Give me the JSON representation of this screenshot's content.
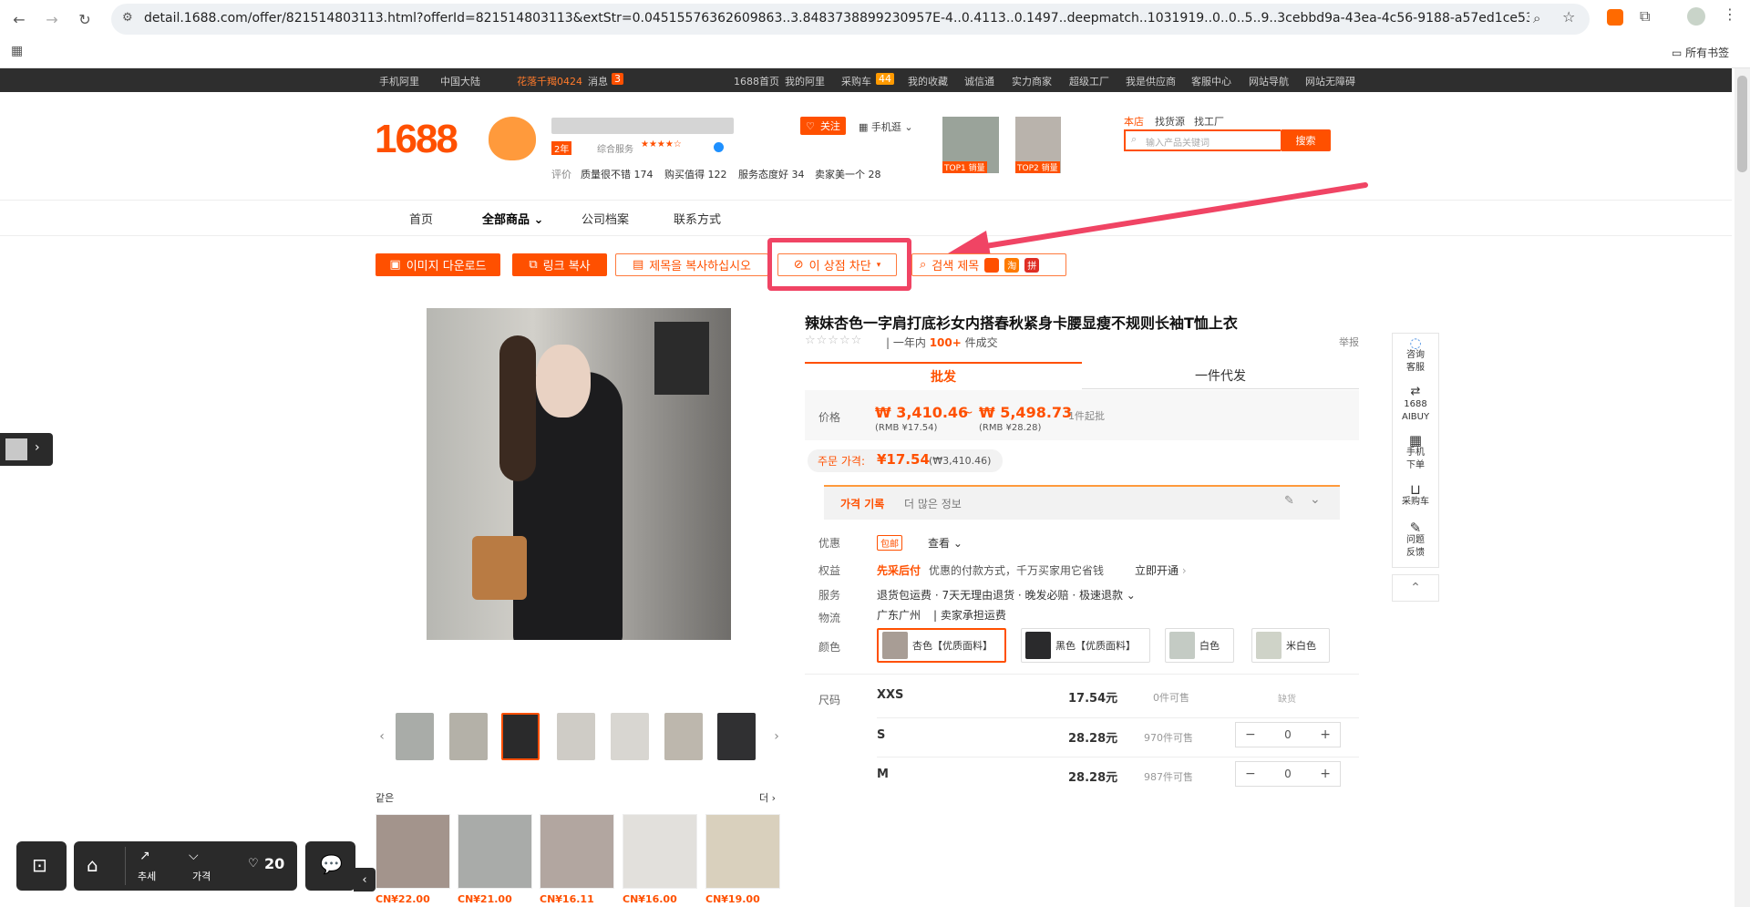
{
  "browser": {
    "url": "detail.1688.com/offer/821514803113.html?offerId=821514803113&extStr=0.04515576362609863..3.8483738899230957E-4..0.4113..0.1497..deepmatch..1031919..0..0..5..9..3cebbd9a-43ea-4c56-9188-a57ed1ce53ea..offer..821...",
    "bookmarks_label": "所有书签"
  },
  "topbar": {
    "items": [
      "手机阿里",
      "中国大陆",
      "花落千羯0424",
      "消息",
      "3",
      "1688首页",
      "我的阿里",
      "采购车",
      "44",
      "我的收藏",
      "诚信通",
      "实力商家",
      "超级工厂",
      "我是供应商",
      "客服中心",
      "网站导航",
      "网站无障碍"
    ]
  },
  "header": {
    "logo": "1688",
    "badge_years": "2年",
    "overall_service": "综合服务",
    "ratings_label": "评价",
    "stats": [
      "质量很不错 174",
      "购买值得 122",
      "服务态度好 34",
      "卖家美一个 28"
    ],
    "follow": "关注",
    "mobile": "手机逛",
    "top1": "TOP1 销量",
    "top2": "TOP2 销量",
    "search_tabs": [
      "本店",
      "找货源",
      "找工厂"
    ],
    "search_placeholder": "输入产品关键词",
    "search_button": "搜索"
  },
  "nav": [
    "首页",
    "全部商品",
    "公司档案",
    "联系方式"
  ],
  "toolbar": {
    "download": "이미지 다운로드",
    "copy_link": "링크 복사",
    "copy_title": "제목을 복사하십시오",
    "block_store": "이 상점 차단",
    "search_title": "검색 제목"
  },
  "product": {
    "title": "辣妹杏色一字肩打底衫女内搭春秋紧身卡腰显瘦不规则长袖T恤上衣",
    "sales_prefix": "一年内",
    "sales_count": "100+",
    "sales_suffix": "件成交",
    "report": "举报",
    "tab_wholesale": "批发",
    "tab_dropship": "一件代发",
    "price_label": "价格",
    "price_low": "₩ 3,410.46",
    "price_low_rmb": "(RMB ¥17.54)",
    "price_sep": "~",
    "price_high": "₩ 5,498.73",
    "price_high_rmb": "(RMB ¥28.28)",
    "moq": "1件起批",
    "order_price_label": "주문 가격:",
    "order_price": "¥17.54",
    "order_price_krw": "(₩3,410.46)",
    "price_history": "가격 기록",
    "more_info": "더 많은 정보",
    "discount_label": "优惠",
    "discount_tag": "包邮",
    "discount_view": "查看",
    "rights_label": "权益",
    "rights_tag": "先采后付",
    "rights_text": "优惠的付款方式，千万买家用它省钱",
    "rights_link": "立即开通",
    "service_label": "服务",
    "service_text": "退货包运费 · 7天无理由退货 · 晚发必赔 · 极速退款",
    "logistics_label": "物流",
    "logistics_from": "广东广州",
    "logistics_text": "卖家承担运费",
    "color_label": "颜色",
    "colors": [
      "杏色【优质面料】",
      "黑色【优质面料】",
      "白色",
      "米白色"
    ],
    "size_label": "尺码",
    "sizes": [
      {
        "name": "XXS",
        "price": "17.54元",
        "stock": "0件可售",
        "qty": "缺货"
      },
      {
        "name": "S",
        "price": "28.28元",
        "stock": "970件可售",
        "qty": "0"
      },
      {
        "name": "M",
        "price": "28.28元",
        "stock": "987件可售",
        "qty": "0"
      }
    ]
  },
  "similar": {
    "title": "같은",
    "more": "더",
    "prices": [
      "CN¥22.00",
      "CN¥21.00",
      "CN¥16.11",
      "CN¥16.00",
      "CN¥19.00"
    ]
  },
  "sidebar": [
    "咨询客服",
    "1688 AIBUY",
    "手机下单",
    "采购车",
    "问题反馈"
  ],
  "bottombar": {
    "trend": "추세",
    "price": "가격",
    "likes": "20"
  }
}
